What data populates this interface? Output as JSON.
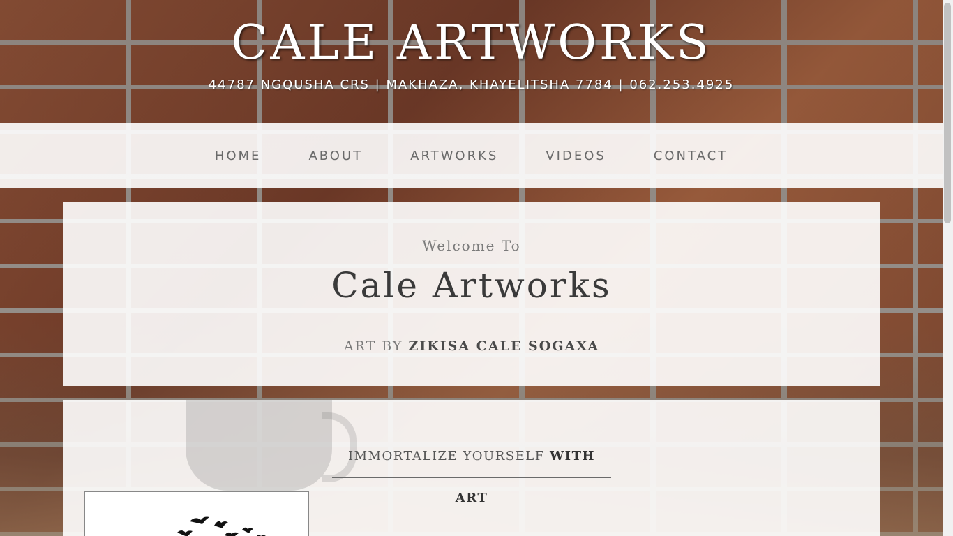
{
  "site": {
    "brand": "CALE ARTWORKS",
    "address": "44787 NGQUSHA CRS | MAKHAZA, KHAYELITSHA 7784 | 062.253.4925"
  },
  "nav": {
    "items": [
      {
        "label": "HOME"
      },
      {
        "label": "ABOUT"
      },
      {
        "label": "ARTWORKS"
      },
      {
        "label": "VIDEOS"
      },
      {
        "label": "CONTACT"
      }
    ]
  },
  "intro": {
    "welcome": "Welcome To",
    "title": "Cale Artworks",
    "art_by_prefix": "ART BY",
    "artist": "ZIKISA CALE SOGAXA"
  },
  "content": {
    "tagline_prefix": "IMMORTALIZE YOURSELF",
    "tagline_emphasis": "WITH ART"
  },
  "icons": {
    "artwork_thumbnail": "birds-silhouette-artwork"
  },
  "colors": {
    "nav_text": "#6a6a6a",
    "title_text": "#3a3a3a",
    "panel_background": "#ffffff"
  }
}
